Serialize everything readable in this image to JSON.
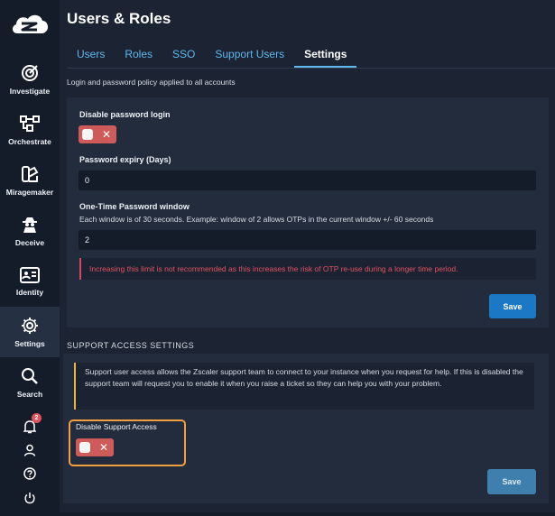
{
  "sidebar": {
    "logo_icon": "zscaler-cloud-logo",
    "items": [
      {
        "label": "Investigate",
        "icon": "target-icon"
      },
      {
        "label": "Orchestrate",
        "icon": "flow-nodes-icon"
      },
      {
        "label": "Miragemaker",
        "icon": "decoy-design-icon"
      },
      {
        "label": "Deceive",
        "icon": "spy-icon"
      },
      {
        "label": "Identity",
        "icon": "id-card-icon"
      },
      {
        "label": "Settings",
        "icon": "gear-icon",
        "active": true
      },
      {
        "label": "Search",
        "icon": "search-icon"
      }
    ],
    "notifications_count": "2"
  },
  "header": {
    "title": "Users & Roles",
    "tabs": [
      {
        "label": "Users"
      },
      {
        "label": "Roles"
      },
      {
        "label": "SSO"
      },
      {
        "label": "Support Users"
      },
      {
        "label": "Settings",
        "active": true
      }
    ]
  },
  "login_policy": {
    "subtitle": "Login and password policy applied to all accounts",
    "disable_password_login_label": "Disable password login",
    "disable_password_login_value": "off",
    "password_expiry_label": "Password expiry (Days)",
    "password_expiry_value": "0",
    "otp_window_label": "One-Time Password window",
    "otp_window_help": "Each window is of 30 seconds. Example: window of 2 allows OTPs in the current window +/- 60 seconds",
    "otp_window_value": "2",
    "otp_warning": "Increasing this limit is not recommended as this increases the risk of OTP re-use during a longer time period.",
    "save_label": "Save"
  },
  "support_access": {
    "heading": "SUPPORT ACCESS SETTINGS",
    "info": "Support user access allows the Zscaler support team to connect to your instance when you request for help. If this is disabled the support team will request you to enable it when you raise a ticket so they can help you with your problem.",
    "disable_label": "Disable Support Access",
    "disable_value": "off",
    "save_label": "Save"
  },
  "colors": {
    "accent": "#5fb8ef",
    "primary_button": "#1b78c5",
    "toggle_off": "#cf5a5a",
    "danger": "#e2525e",
    "warning": "#e8b640",
    "highlight": "#f0a03c"
  }
}
